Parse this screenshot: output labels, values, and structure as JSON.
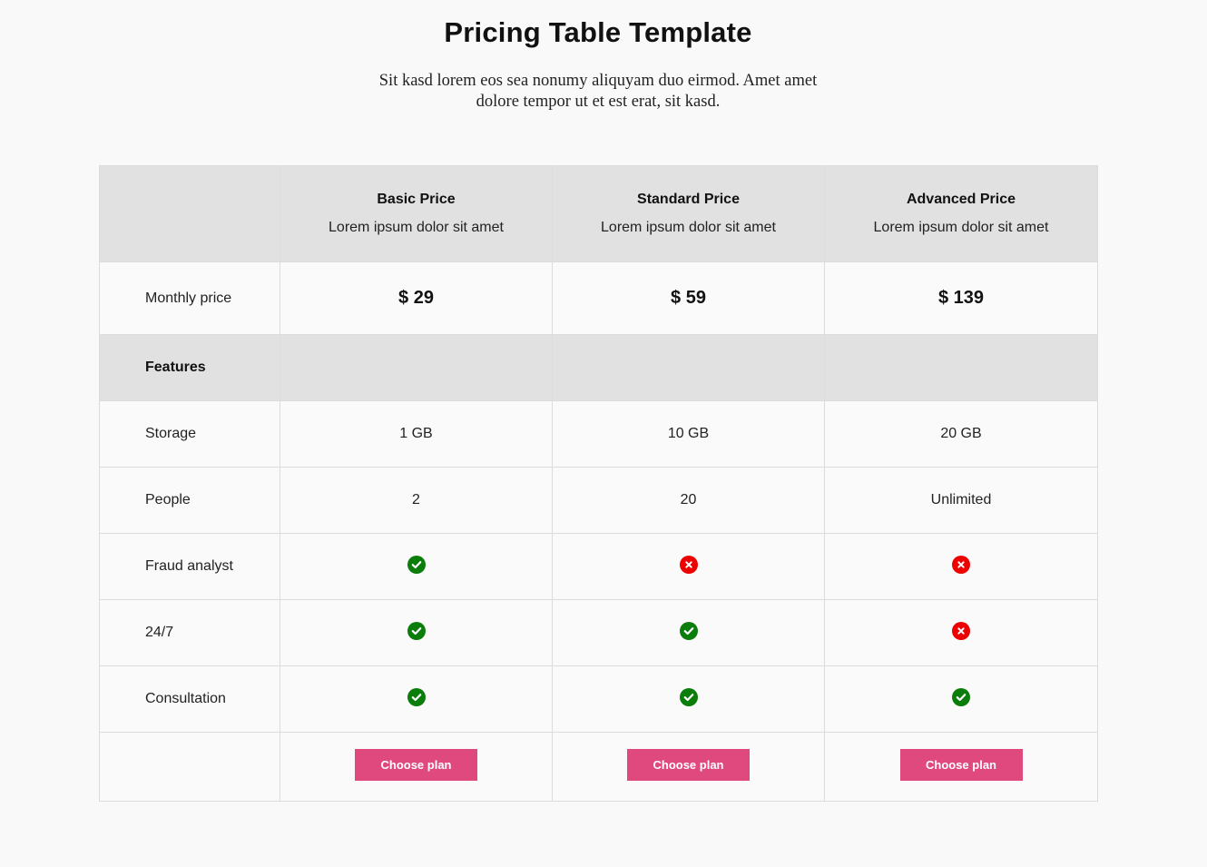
{
  "page": {
    "title": "Pricing Table Template",
    "subtitle": "Sit kasd lorem eos sea nonumy aliquyam duo eirmod. Amet amet dolore tempor ut et est erat, sit kasd."
  },
  "plans": [
    {
      "name": "Basic Price",
      "description": "Lorem ipsum dolor sit amet",
      "price": "$ 29",
      "button_label": "Choose plan"
    },
    {
      "name": "Standard Price",
      "description": "Lorem ipsum dolor sit amet",
      "price": "$ 59",
      "button_label": "Choose plan"
    },
    {
      "name": "Advanced Price",
      "description": "Lorem ipsum dolor sit amet",
      "price": "$ 139",
      "button_label": "Choose plan"
    }
  ],
  "price_row_label": "Monthly price",
  "features_heading": "Features",
  "features": [
    {
      "label": "Storage",
      "values": [
        "1 GB",
        "10 GB",
        "20 GB"
      ]
    },
    {
      "label": "People",
      "values": [
        "2",
        "20",
        "Unlimited"
      ]
    },
    {
      "label": "Fraud analyst",
      "values": [
        "check",
        "cross",
        "cross"
      ]
    },
    {
      "label": "24/7",
      "values": [
        "check",
        "check",
        "cross"
      ]
    },
    {
      "label": "Consultation",
      "values": [
        "check",
        "check",
        "check"
      ]
    }
  ],
  "colors": {
    "check": "#0a7d0a",
    "cross": "#ec0000",
    "button": "#e0497e",
    "header_bg": "#e1e1e1"
  }
}
